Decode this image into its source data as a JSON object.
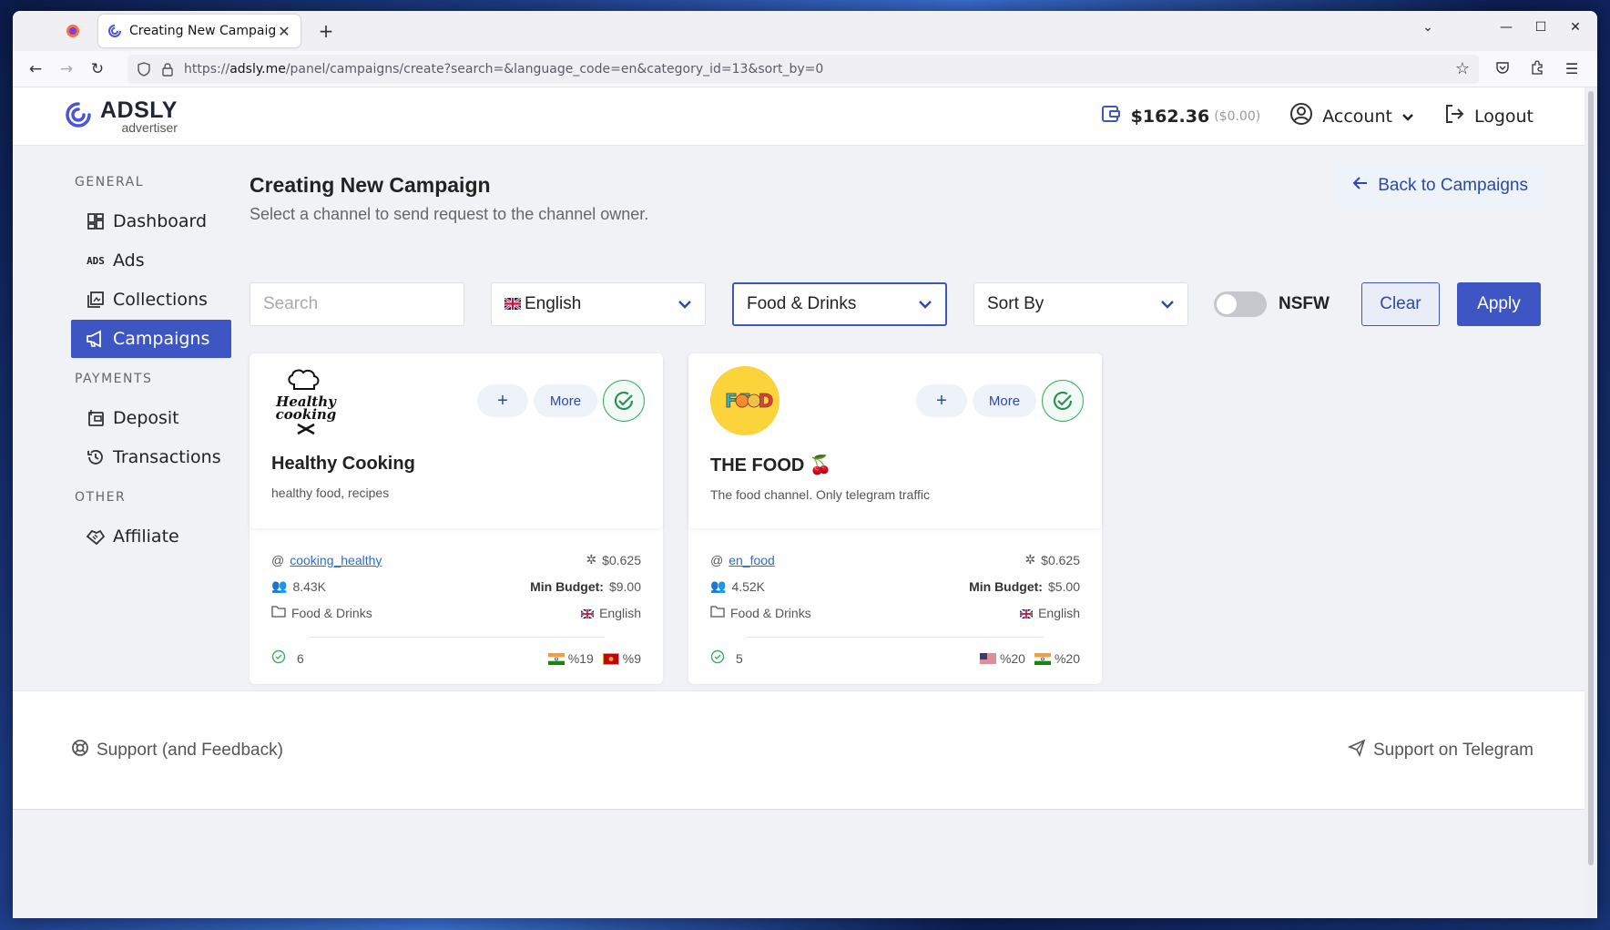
{
  "browser": {
    "tab_title": "Creating New Campaign",
    "tab_close": "✕",
    "new_tab": "+",
    "url_prefix": "https://",
    "url_domain": "adsly.me",
    "url_rest": "/panel/campaigns/create?search=&language_code=en&category_id=13&sort_by=0"
  },
  "header": {
    "brand": "ADSLY",
    "brand_sub": "advertiser",
    "balance": "$162.36",
    "balance_hold": "($0.00)",
    "account": "Account",
    "logout": "Logout"
  },
  "sidebar": {
    "groups": [
      {
        "label": "GENERAL"
      },
      {
        "label": "PAYMENTS"
      },
      {
        "label": "OTHER"
      }
    ],
    "items": [
      {
        "label": "Dashboard",
        "icon": "dashboard-icon"
      },
      {
        "label": "Ads",
        "icon": "ads-icon"
      },
      {
        "label": "Collections",
        "icon": "collections-icon"
      },
      {
        "label": "Campaigns",
        "icon": "megaphone-icon",
        "active": true
      },
      {
        "label": "Deposit",
        "icon": "deposit-icon"
      },
      {
        "label": "Transactions",
        "icon": "history-icon"
      },
      {
        "label": "Affiliate",
        "icon": "handshake-icon"
      }
    ]
  },
  "main": {
    "title": "Creating New Campaign",
    "subtitle": "Select a channel to send request to the channel owner.",
    "back_button": "Back to Campaigns"
  },
  "filters": {
    "search_placeholder": "Search",
    "search_value": "",
    "language": "English",
    "category": "Food & Drinks",
    "sort": "Sort By",
    "nsfw_label": "NSFW",
    "nsfw_on": false,
    "clear": "Clear",
    "apply": "Apply"
  },
  "cards": [
    {
      "name": "Healthy Cooking",
      "desc": "healthy food, recipes",
      "plus": "+",
      "more": "More",
      "handle": "cooking_healthy",
      "price": "$0.625",
      "subscribers": "8.43K",
      "min_budget_label": "Min Budget:",
      "min_budget": "$9.00",
      "category": "Food & Drinks",
      "language": "English",
      "completed": "6",
      "geo": [
        {
          "flag": "india",
          "pct": "%19"
        },
        {
          "flag": "montenegro",
          "pct": "%9"
        }
      ]
    },
    {
      "name": "THE FOOD 🍒",
      "desc": "The food channel. Only telegram traffic",
      "plus": "+",
      "more": "More",
      "handle": "en_food",
      "price": "$0.625",
      "subscribers": "4.52K",
      "min_budget_label": "Min Budget:",
      "min_budget": "$5.00",
      "category": "Food & Drinks",
      "language": "English",
      "completed": "5",
      "geo": [
        {
          "flag": "usa",
          "pct": "%20"
        },
        {
          "flag": "india",
          "pct": "%20"
        }
      ]
    }
  ],
  "footer": {
    "support": "Support (and Feedback)",
    "telegram": "Support on Telegram"
  },
  "colors": {
    "primary": "#3e55c4",
    "link": "#2b4aa8",
    "success": "#3aab6b"
  }
}
